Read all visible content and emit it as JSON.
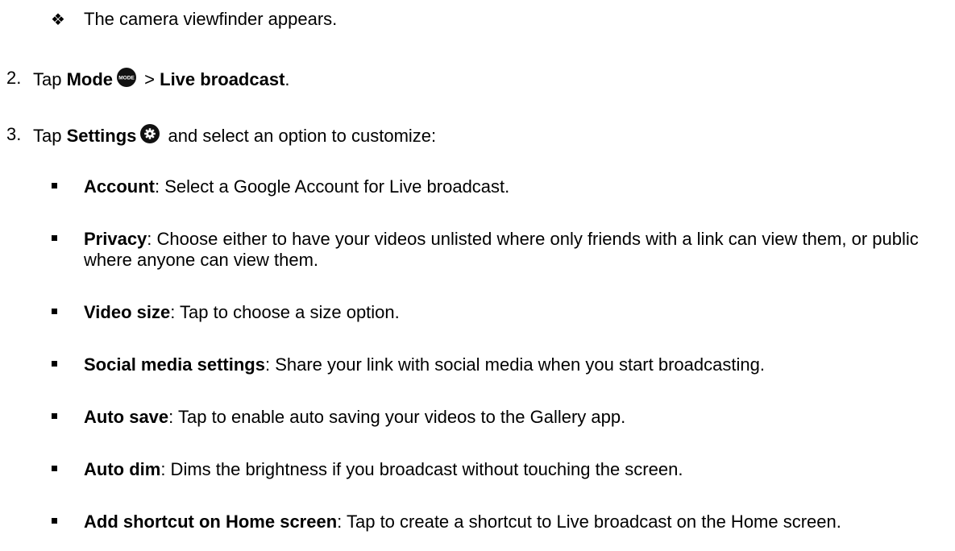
{
  "intro_bullet": {
    "glyph": "❖",
    "text": "The camera viewfinder appears."
  },
  "steps": [
    {
      "number": "2.",
      "prefix": "Tap ",
      "bold1": "Mode",
      "icon": "mode-icon",
      "icon_text": "MODE",
      "middle": " > ",
      "bold2": "Live broadcast",
      "suffix": "."
    },
    {
      "number": "3.",
      "prefix": "Tap ",
      "bold1": "Settings",
      "icon": "gear-icon",
      "suffix": " and select an option to customize:"
    }
  ],
  "options": [
    {
      "term": "Account",
      "desc": ": Select a Google Account for Live broadcast."
    },
    {
      "term": "Privacy",
      "desc": ": Choose either to have your videos unlisted where only friends with a link can view them, or public where anyone can view them."
    },
    {
      "term": "Video size",
      "desc": ": Tap to choose a size option."
    },
    {
      "term": "Social media settings",
      "desc": ": Share your link with social media when you start broadcasting."
    },
    {
      "term": "Auto save",
      "desc": ": Tap to enable auto saving your videos to the Gallery app."
    },
    {
      "term": "Auto dim",
      "desc": ": Dims the brightness if you broadcast without touching the screen."
    },
    {
      "term": "Add shortcut on Home screen",
      "desc": ": Tap to create a shortcut to Live broadcast on the Home screen."
    }
  ]
}
